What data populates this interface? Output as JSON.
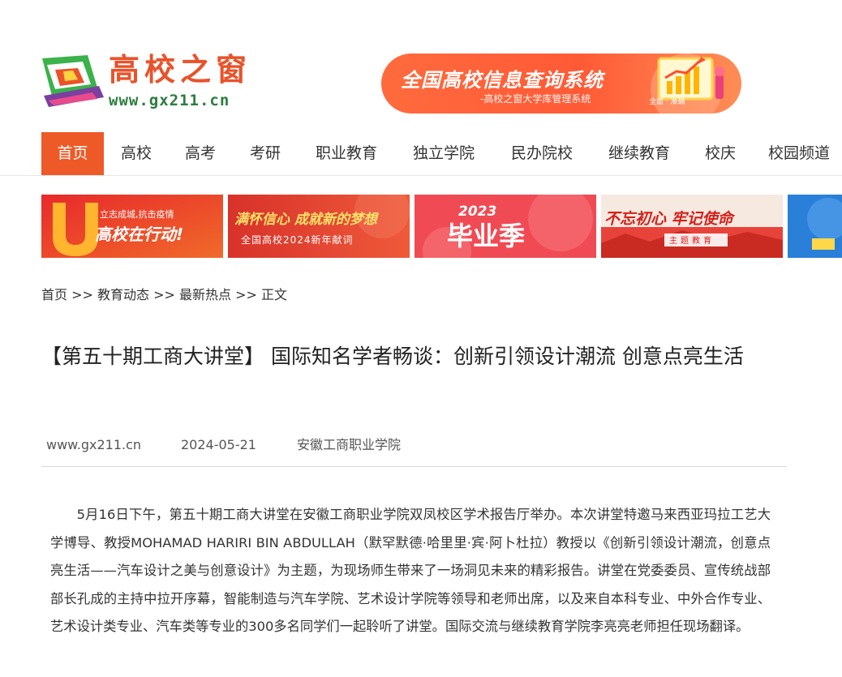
{
  "site": {
    "name": "高校之窗",
    "url": "www.gx211.cn"
  },
  "banner": {
    "title": "全国高校信息查询系统",
    "subtitle": "-高校之窗大学库管理系统",
    "tag": "全面 · 准确",
    "colors": {
      "start": "#ff6b3d",
      "end": "#ff8d55"
    }
  },
  "nav": {
    "items": [
      "首页",
      "高校",
      "高考",
      "考研",
      "职业教育",
      "独立学院",
      "民办院校",
      "继续教育",
      "校庆",
      "校园频道"
    ],
    "active_index": 0,
    "active_color": "#ee5a27"
  },
  "promos": [
    {
      "line1": "立志成城,抗击疫情",
      "line2": "高校在行动!"
    },
    {
      "line1": "满怀信心 成就新的梦想",
      "line2": "全国高校2024新年献词"
    },
    {
      "line1": "2023",
      "line2": "毕业季"
    },
    {
      "line1": "不忘初心 牢记使命",
      "line2": "主题教育"
    }
  ],
  "breadcrumb": [
    "首页",
    ">>",
    "教育动态",
    ">>",
    "最新热点",
    ">>",
    "正文"
  ],
  "article": {
    "title": "【第五十期工商大讲堂】 国际知名学者畅谈：创新引领设计潮流 创意点亮生活",
    "source": "www.gx211.cn",
    "date": "2024-05-21",
    "org": "安徽工商职业学院",
    "paragraph": "5月16日下午，第五十期工商大讲堂在安徽工商职业学院双凤校区学术报告厅举办。本次讲堂特邀马来西亚玛拉工艺大学博导、教授MOHAMAD HARIRI BIN ABDULLAH（默罕默德·哈里里·宾·阿卜杜拉）教授以《创新引领设计潮流，创意点亮生活——汽车设计之美与创意设计》为主题，为现场师生带来了一场洞见未来的精彩报告。讲堂在党委委员、宣传统战部部长孔成的主持中拉开序幕，智能制造与汽车学院、艺术设计学院等领导和老师出席，以及来自本科专业、中外合作专业、艺术设计类专业、汽车类等专业的300多名同学们一起聆听了讲堂。国际交流与继续教育学院李亮亮老师担任现场翻译。"
  }
}
